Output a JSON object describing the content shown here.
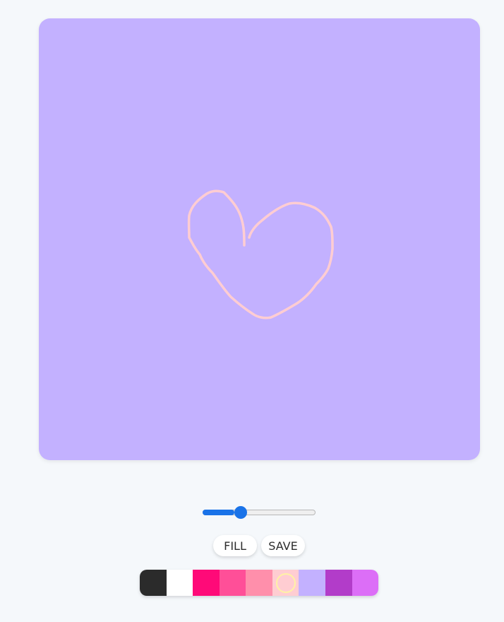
{
  "canvas": {
    "background": "#c3b1ff",
    "stroke_color": "#ffcdd2"
  },
  "brush": {
    "size_fraction": 0.28
  },
  "toolbar": {
    "fill_label": "FILL",
    "save_label": "SAVE"
  },
  "palette": {
    "colors": [
      "#2b2b2b",
      "#ffffff",
      "#ff0a78",
      "#ff4f98",
      "#ff8fab",
      "#ffcdd2",
      "#c3b1ff",
      "#b23cc9",
      "#dc6ef7"
    ],
    "selected_index": 5
  }
}
